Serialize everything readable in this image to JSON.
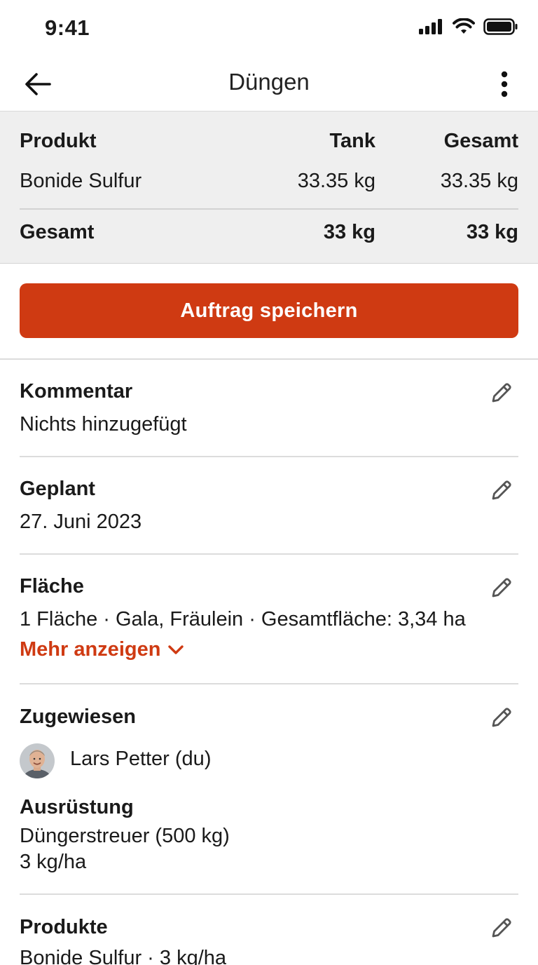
{
  "status_bar": {
    "time": "9:41"
  },
  "nav": {
    "title": "Düngen"
  },
  "summary": {
    "headers": {
      "product": "Produkt",
      "tank": "Tank",
      "total": "Gesamt"
    },
    "rows": [
      {
        "product": "Bonide Sulfur",
        "tank": "33.35 kg",
        "total": "33.35 kg"
      }
    ],
    "totals": {
      "label": "Gesamt",
      "tank": "33 kg",
      "total": "33 kg"
    }
  },
  "save_button": {
    "label": "Auftrag speichern"
  },
  "comment": {
    "label": "Kommentar",
    "value": "Nichts hinzugefügt"
  },
  "planned": {
    "label": "Geplant",
    "value": "27. Juni 2023"
  },
  "area": {
    "label": "Fläche",
    "value": "1 Fläche · Gala, Fräulein · Gesamtfläche: 3,34 ha",
    "more_label": "Mehr anzeigen"
  },
  "assigned": {
    "label": "Zugewiesen",
    "person": "Lars Petter (du)"
  },
  "equipment": {
    "label": "Ausrüstung",
    "name": "Düngerstreuer (500 kg)",
    "rate": "3 kg/ha"
  },
  "products": {
    "label": "Produkte",
    "value": "Bonide Sulfur · 3 kg/ha"
  },
  "colors": {
    "accent": "#cf3a12",
    "summary_bg": "#efefef"
  }
}
